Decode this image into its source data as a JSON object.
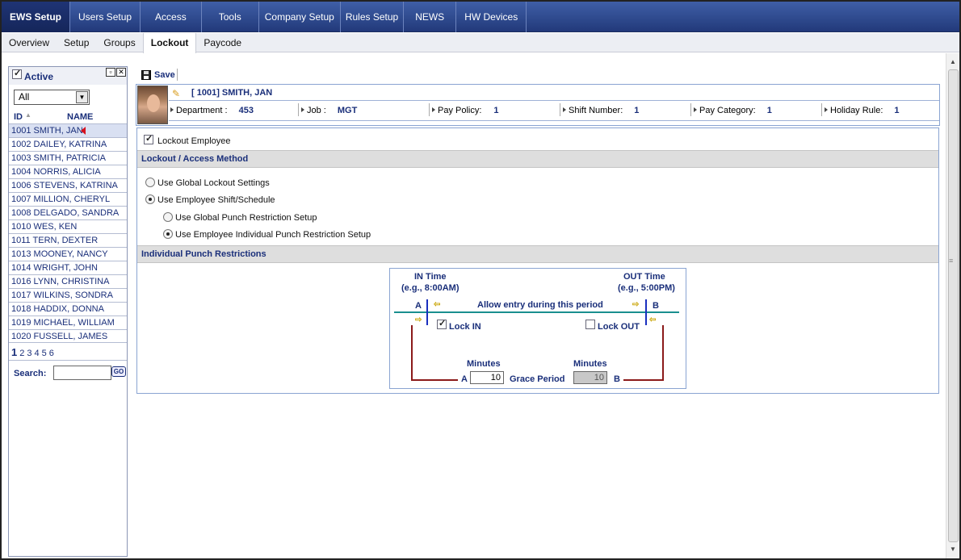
{
  "topnav": {
    "items": [
      "EWS Setup",
      "Users Setup",
      "Access",
      "Tools",
      "Company Setup",
      "Rules Setup",
      "NEWS",
      "HW Devices"
    ],
    "active": "EWS Setup"
  },
  "subnav": {
    "items": [
      "Overview",
      "Setup",
      "Groups",
      "Lockout",
      "Paycode"
    ],
    "active": "Lockout"
  },
  "left_panel": {
    "active_label": "Active",
    "active_checked": true,
    "filter_value": "All",
    "col_id": "ID",
    "col_name": "NAME",
    "employees": [
      "1001 SMITH, JAN",
      "1002 DAILEY, KATRINA",
      "1003 SMITH, PATRICIA",
      "1004 NORRIS, ALICIA",
      "1006 STEVENS, KATRINA",
      "1007 MILLION, CHERYL",
      "1008 DELGADO, SANDRA",
      "1010 WES, KEN",
      "1011 TERN, DEXTER",
      "1013 MOONEY, NANCY",
      "1014 WRIGHT, JOHN",
      "1016 LYNN, CHRISTINA",
      "1017 WILKINS, SONDRA",
      "1018 HADDIX, DONNA",
      "1019 MICHAEL, WILLIAM",
      "1020 FUSSELL, JAMES"
    ],
    "selected_index": 0,
    "pages": [
      "1",
      "2",
      "3",
      "4",
      "5",
      "6"
    ],
    "current_page": "1",
    "search_label": "Search:",
    "go_label": "GO"
  },
  "toolbar": {
    "save_label": "Save"
  },
  "employee": {
    "title": "[ 1001] SMITH, JAN",
    "department_label": "Department :",
    "department_value": "453",
    "job_label": "Job :",
    "job_value": "MGT",
    "pay_policy_label": "Pay Policy:",
    "pay_policy_value": "1",
    "shift_number_label": "Shift Number:",
    "shift_number_value": "1",
    "pay_category_label": "Pay Category:",
    "pay_category_value": "1",
    "holiday_rule_label": "Holiday Rule:",
    "holiday_rule_value": "1"
  },
  "lockout": {
    "lockout_employee_label": "Lockout Employee",
    "lockout_employee_checked": true,
    "section_access": "Lockout / Access Method",
    "opt_global": "Use Global Lockout Settings",
    "opt_shift": "Use Employee Shift/Schedule",
    "opt_global_punch": "Use Global Punch Restriction Setup",
    "opt_individual_punch": "Use Employee Individual Punch Restriction Setup",
    "selected_method": "Use Employee Shift/Schedule",
    "selected_sub_method": "Use Employee Individual Punch Restriction Setup",
    "section_punch": "Individual Punch Restrictions"
  },
  "diagram": {
    "in_time": "IN Time",
    "in_example": "(e.g., 8:00AM)",
    "out_time": "OUT Time",
    "out_example": "(e.g., 5:00PM)",
    "point_a": "A",
    "point_b": "B",
    "allow_entry": "Allow entry during this period",
    "lock_in_label": "Lock IN",
    "lock_in_checked": true,
    "lock_out_label": "Lock OUT",
    "lock_out_checked": false,
    "minutes_label": "Minutes",
    "grace_period_label": "Grace Period",
    "grace_in_minutes": "10",
    "grace_out_minutes": "10",
    "colors": {
      "timeline": "#1a8f8f",
      "bracket": "#8b1a1a",
      "marker": "#1a2fbf"
    }
  }
}
